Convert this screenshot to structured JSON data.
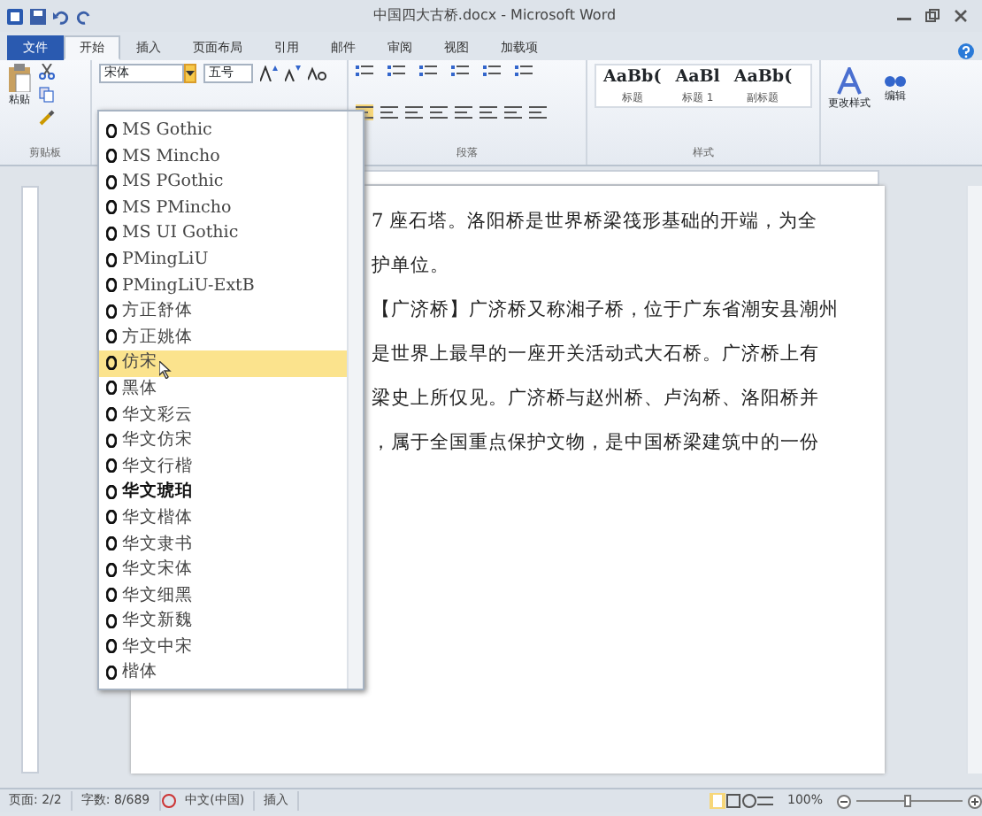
{
  "window": {
    "title": "中国四大古桥.docx - Microsoft Word"
  },
  "tabs": [
    {
      "label": "文件",
      "selected": false,
      "kind": "file"
    },
    {
      "label": "开始",
      "selected": true,
      "kind": "tab"
    },
    {
      "label": "插入",
      "selected": false,
      "kind": "tab"
    },
    {
      "label": "页面布局",
      "selected": false,
      "kind": "tab"
    },
    {
      "label": "引用",
      "selected": false,
      "kind": "tab"
    },
    {
      "label": "邮件",
      "selected": false,
      "kind": "tab"
    },
    {
      "label": "审阅",
      "selected": false,
      "kind": "tab"
    },
    {
      "label": "视图",
      "selected": false,
      "kind": "tab"
    },
    {
      "label": "加载项",
      "selected": false,
      "kind": "tab"
    }
  ],
  "ribbon": {
    "clipboard": {
      "paste": "粘贴",
      "label": "剪贴板"
    },
    "font": {
      "name": "宋体",
      "size": "五号"
    },
    "paragraph": {
      "label": "段落"
    },
    "styles": {
      "items": [
        {
          "preview": "AaBb(",
          "name": "标题"
        },
        {
          "preview": "AaBl",
          "name": "标题 1"
        },
        {
          "preview": "AaBb(",
          "name": "副标题"
        }
      ],
      "change": "更改样式",
      "label": "样式"
    },
    "editing": "编辑"
  },
  "font_dropdown": {
    "items": [
      {
        "name": "MS Gothic",
        "selected": false,
        "bold": false
      },
      {
        "name": "MS Mincho",
        "selected": false,
        "bold": false
      },
      {
        "name": "MS PGothic",
        "selected": false,
        "bold": false
      },
      {
        "name": "MS PMincho",
        "selected": false,
        "bold": false
      },
      {
        "name": "MS UI Gothic",
        "selected": false,
        "bold": false
      },
      {
        "name": "PMingLiU",
        "selected": false,
        "bold": false
      },
      {
        "name": "PMingLiU-ExtB",
        "selected": false,
        "bold": false
      },
      {
        "name": "方正舒体",
        "selected": false,
        "bold": false
      },
      {
        "name": "方正姚体",
        "selected": false,
        "bold": false
      },
      {
        "name": "仿宋",
        "selected": true,
        "bold": false
      },
      {
        "name": "黑体",
        "selected": false,
        "bold": false
      },
      {
        "name": "华文彩云",
        "selected": false,
        "bold": false
      },
      {
        "name": "华文仿宋",
        "selected": false,
        "bold": false
      },
      {
        "name": "华文行楷",
        "selected": false,
        "bold": false
      },
      {
        "name": "华文琥珀",
        "selected": false,
        "bold": true
      },
      {
        "name": "华文楷体",
        "selected": false,
        "bold": false
      },
      {
        "name": "华文隶书",
        "selected": false,
        "bold": false
      },
      {
        "name": "华文宋体",
        "selected": false,
        "bold": false
      },
      {
        "name": "华文细黑",
        "selected": false,
        "bold": false
      },
      {
        "name": "华文新魏",
        "selected": false,
        "bold": false
      },
      {
        "name": "华文中宋",
        "selected": false,
        "bold": false
      },
      {
        "name": "楷体",
        "selected": false,
        "bold": false
      }
    ]
  },
  "document": {
    "lines": [
      "7 座石塔。洛阳桥是世界桥梁筏形基础的开端，为全",
      "护单位。",
      "【广济桥】广济桥又称湘子桥，位于广东省潮安县潮州",
      "是世界上最早的一座开关活动式大石桥。广济桥上有",
      "梁史上所仅见。广济桥与赵州桥、卢沟桥、洛阳桥并",
      "，属于全国重点保护文物，是中国桥梁建筑中的一份"
    ]
  },
  "status_bar": {
    "page": "页面: 2/2",
    "words": "字数: 8/689",
    "language": "中文(中国)",
    "mode": "插入",
    "zoom": "100%",
    "zoom_slider": {
      "level": 0.5
    }
  }
}
